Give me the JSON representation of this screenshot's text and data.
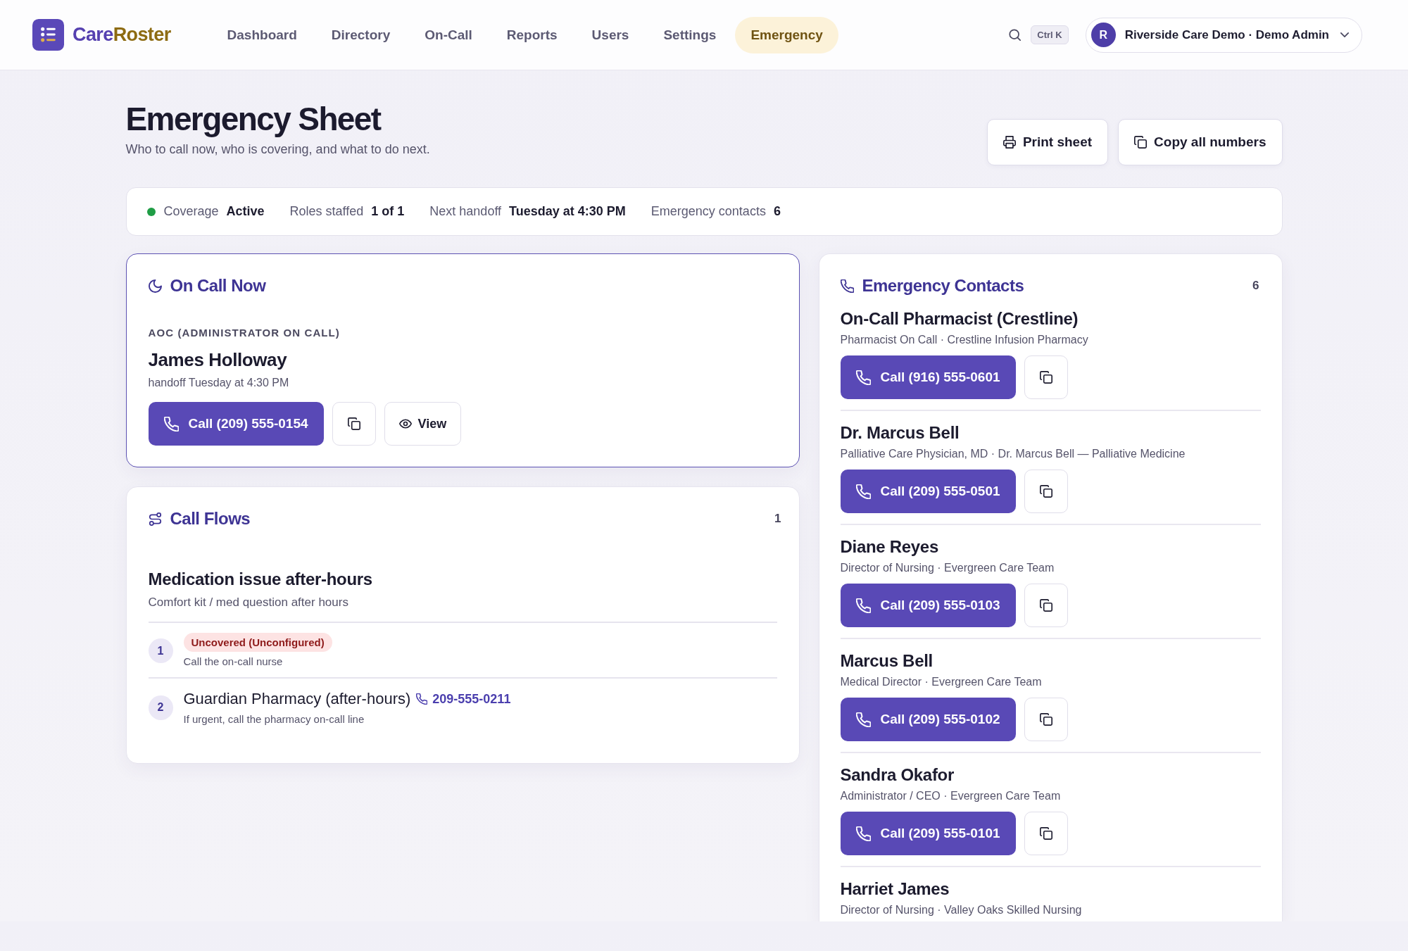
{
  "brand": {
    "name_parts": [
      "Care",
      "Roster"
    ]
  },
  "nav": [
    {
      "label": "Dashboard",
      "selected": false
    },
    {
      "label": "Directory",
      "selected": false
    },
    {
      "label": "On-Call",
      "selected": false
    },
    {
      "label": "Reports",
      "selected": false
    },
    {
      "label": "Users",
      "selected": false
    },
    {
      "label": "Settings",
      "selected": false
    },
    {
      "label": "Emergency",
      "selected": true
    }
  ],
  "search": {
    "shortcut": "Ctrl K"
  },
  "account": {
    "avatar_initial": "R",
    "label": "Riverside Care Demo · Demo Admin"
  },
  "page": {
    "title": "Emergency Sheet",
    "subtitle": "Who to call now, who is covering, and what to do next.",
    "actions": [
      {
        "kind": "print",
        "label": "Print sheet"
      },
      {
        "kind": "copy",
        "label": "Copy all numbers"
      }
    ]
  },
  "summary": [
    {
      "kind": "status",
      "label": "Coverage",
      "value": "Active"
    },
    {
      "kind": "plain",
      "label": "Roles staffed",
      "value": "1 of 1"
    },
    {
      "kind": "plain",
      "label": "Next handoff",
      "value": "Tuesday at 4:30 PM"
    },
    {
      "kind": "plain",
      "label": "Emergency contacts",
      "value": "6"
    }
  ],
  "on_call": {
    "title": "On Call Now",
    "role": "AOC (ADMINISTRATOR ON CALL)",
    "name": "James Holloway",
    "note": "handoff Tuesday at 4:30 PM",
    "call_label": "Call (209) 555-0154",
    "view_label": "View"
  },
  "call_flows": {
    "title": "Call Flows",
    "count": "1",
    "flows": [
      {
        "title": "Medication issue after-hours",
        "description": "Comfort kit / med question after hours",
        "steps": [
          {
            "number": "1",
            "kind": "uncovered",
            "badge": "Uncovered (Unconfigured)",
            "note": "Call the on-call nurse"
          },
          {
            "number": "2",
            "kind": "contact",
            "name": "Guardian Pharmacy (after-hours)",
            "phone": "209-555-0211",
            "note": "If urgent, call the pharmacy on-call line"
          }
        ]
      }
    ]
  },
  "emergency_contacts": {
    "title": "Emergency Contacts",
    "count": "6",
    "contacts": [
      {
        "name": "On-Call Pharmacist (Crestline)",
        "detail": "Pharmacist On Call · Crestline Infusion Pharmacy",
        "call_label": "Call (916) 555-0601"
      },
      {
        "name": "Dr. Marcus Bell",
        "detail": "Palliative Care Physician, MD · Dr. Marcus Bell — Palliative Medicine",
        "call_label": "Call (209) 555-0501"
      },
      {
        "name": "Diane Reyes",
        "detail": "Director of Nursing · Evergreen Care Team",
        "call_label": "Call (209) 555-0103"
      },
      {
        "name": "Marcus Bell",
        "detail": "Medical Director · Evergreen Care Team",
        "call_label": "Call (209) 555-0102"
      },
      {
        "name": "Sandra Okafor",
        "detail": "Administrator / CEO · Evergreen Care Team",
        "call_label": "Call (209) 555-0101"
      },
      {
        "name": "Harriet James",
        "detail": "Director of Nursing · Valley Oaks Skilled Nursing"
      }
    ]
  }
}
